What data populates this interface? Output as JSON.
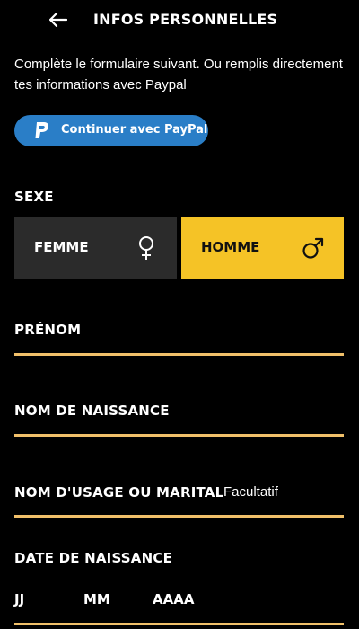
{
  "header": {
    "title": "INFOS PERSONNELLES",
    "back_icon": "arrow-left-icon"
  },
  "intro": {
    "text": "Complète le formulaire suivant. Ou remplis directement tes informations avec Paypal"
  },
  "paypal": {
    "label": "Continuer avec PayPal",
    "icon": "paypal-icon",
    "color": "#2a7ec7"
  },
  "gender": {
    "label": "SEXE",
    "options": [
      {
        "label": "FEMME",
        "icon": "female-symbol-icon",
        "selected": false
      },
      {
        "label": "HOMME",
        "icon": "male-symbol-icon",
        "selected": true
      }
    ],
    "selected_color": "#f5c326",
    "unselected_color": "#2b2b2b"
  },
  "fields": {
    "prenom": {
      "label": "PRÉNOM",
      "value": ""
    },
    "nom_naissance": {
      "label": "NOM DE NAISSANCE",
      "value": ""
    },
    "nom_usage": {
      "label": "NOM D'USAGE OU MARITAL",
      "hint": "Facultatif",
      "value": ""
    },
    "date_naissance": {
      "label": "DATE DE NAISSANCE",
      "day": "JJ",
      "month": "MM",
      "year": "AAAA"
    }
  },
  "accent_line_color": "#f0c06a"
}
